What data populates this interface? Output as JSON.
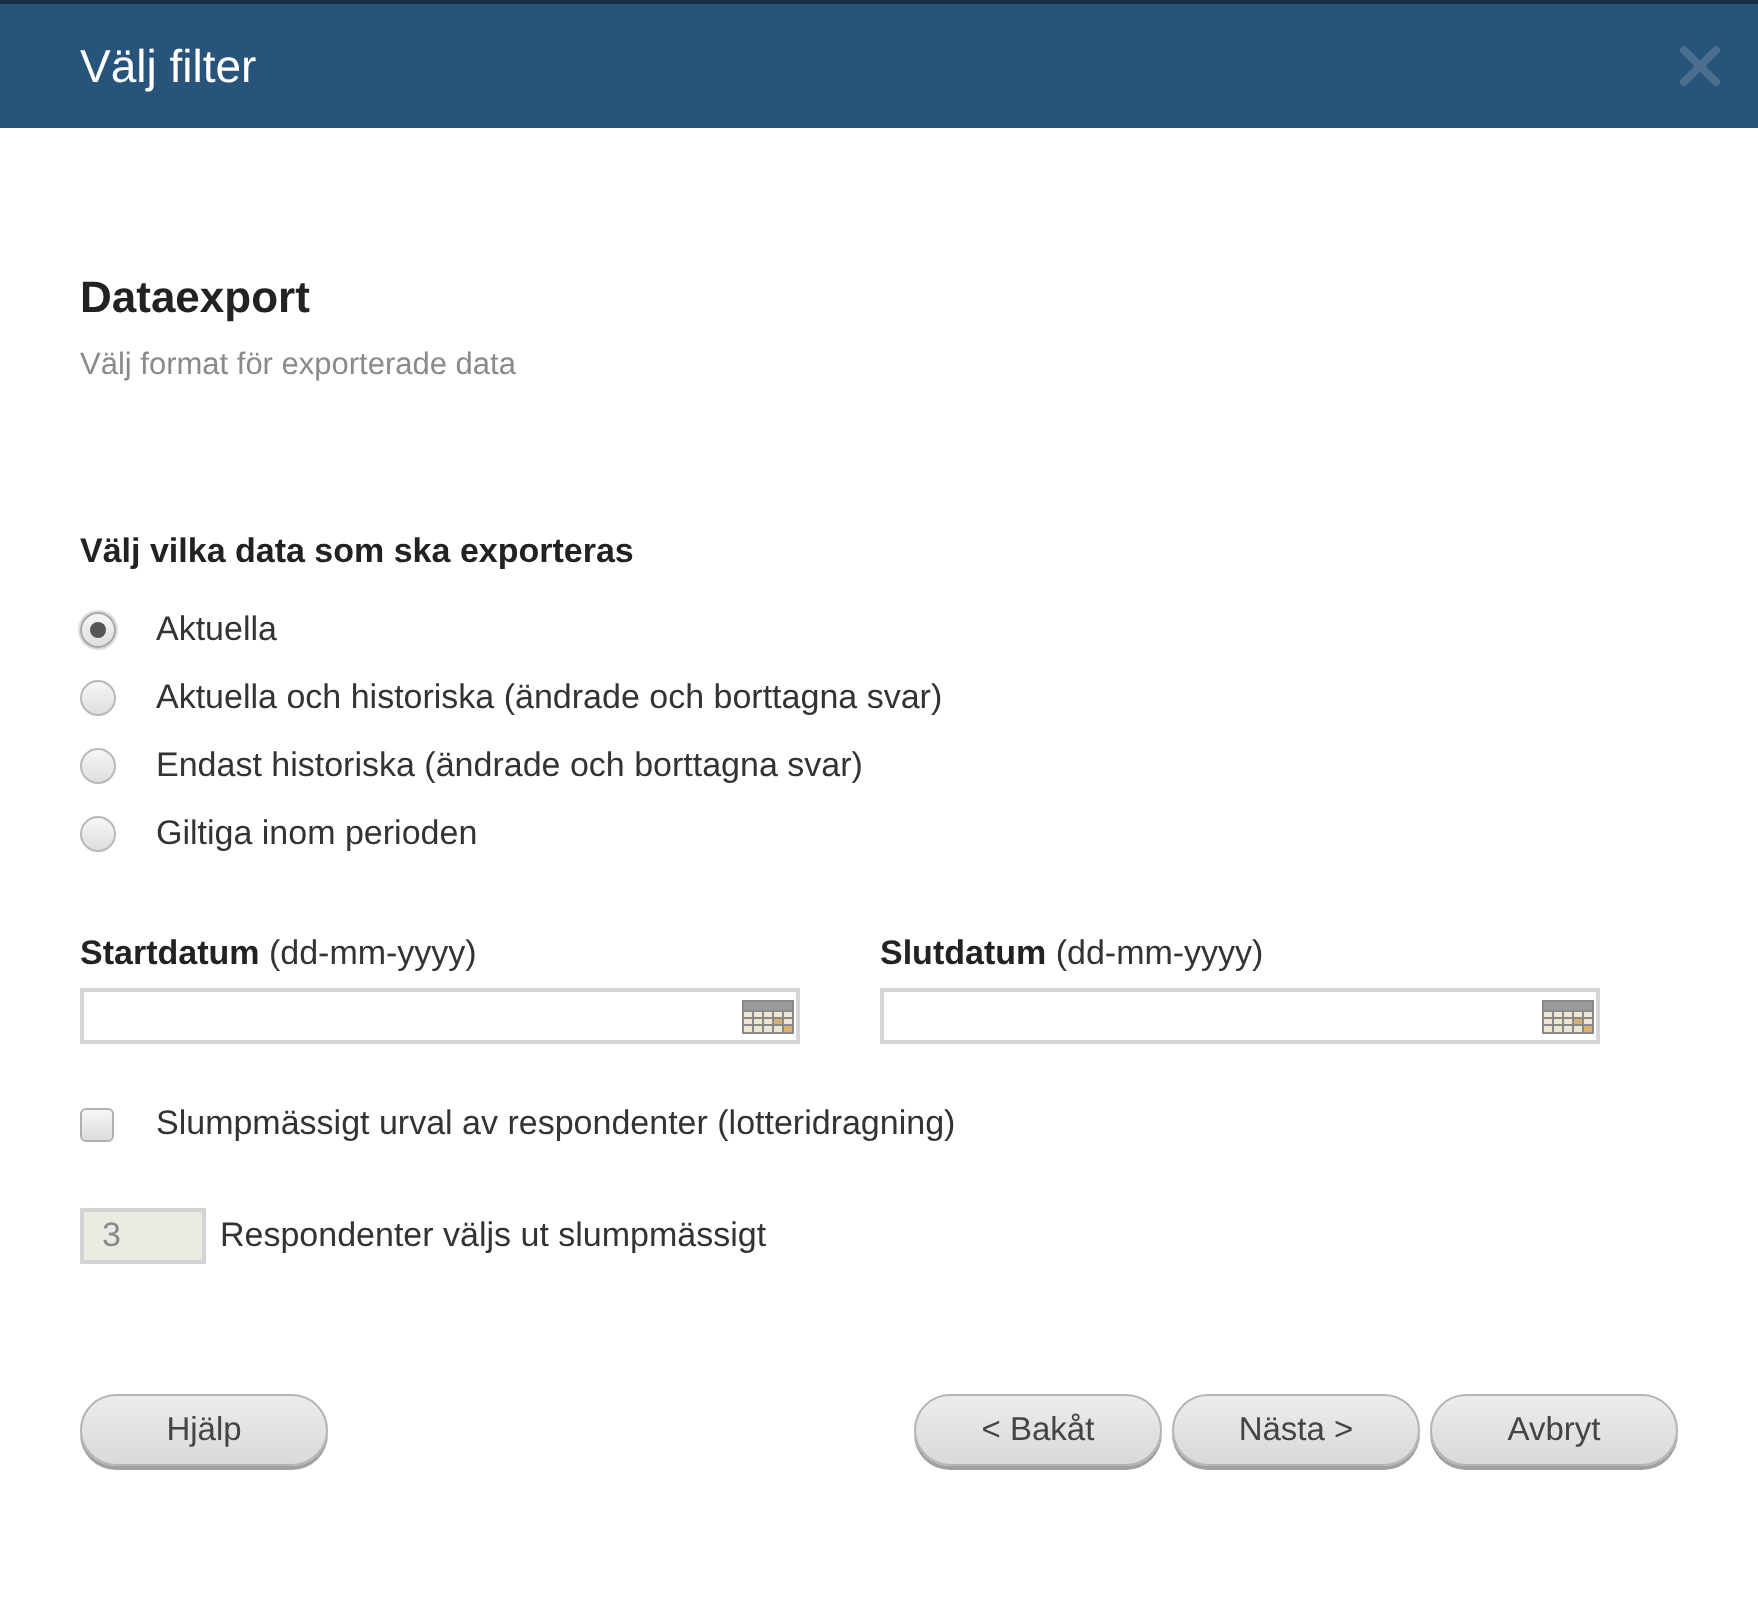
{
  "dialog": {
    "title": "Välj filter"
  },
  "section": {
    "heading": "Dataexport",
    "subtitle": "Välj format för exporterade data"
  },
  "export_choice": {
    "label": "Välj vilka data som ska exporteras",
    "options": [
      {
        "label": "Aktuella",
        "selected": true
      },
      {
        "label": "Aktuella och historiska (ändrade och borttagna svar)",
        "selected": false
      },
      {
        "label": "Endast historiska (ändrade och borttagna svar)",
        "selected": false
      },
      {
        "label": "Giltiga inom perioden",
        "selected": false
      }
    ]
  },
  "date_fields": [
    {
      "label": "**Startdatum** (dd-mm-yyyy)"
    },
    {
      "label": "**Slutdatum** (dd-mm-yyyy)"
    }
  ],
  "random_sample": {
    "label": "Slumpmässigt urval av respondenter (lotteridragning)",
    "checked": false
  },
  "respondent_count": {
    "value": "3",
    "label": "Respondenter väljs ut slumpmässigt",
    "disabled": true
  },
  "buttons": [
    {
      "label": "Hjälp",
      "kind": "help"
    },
    {
      "label": "< Bakåt",
      "kind": "nav"
    },
    {
      "label": "Nästa >",
      "kind": "nav"
    },
    {
      "label": "Avbryt",
      "kind": "nav"
    }
  ]
}
